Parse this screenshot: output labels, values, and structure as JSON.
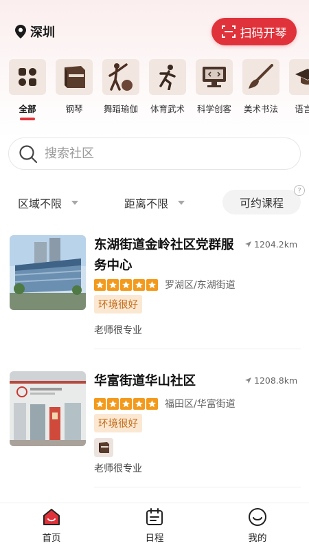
{
  "header": {
    "location": "深圳",
    "scan_button": "扫码开琴"
  },
  "categories": [
    {
      "label": "全部",
      "icon": "grid-icon",
      "active": true
    },
    {
      "label": "钢琴",
      "icon": "piano-icon"
    },
    {
      "label": "舞蹈瑜伽",
      "icon": "dancer-icon"
    },
    {
      "label": "体育武术",
      "icon": "runner-icon"
    },
    {
      "label": "科学创客",
      "icon": "monitor-icon"
    },
    {
      "label": "美术书法",
      "icon": "brush-icon"
    },
    {
      "label": "语言口",
      "icon": "graduation-cap-icon"
    }
  ],
  "search": {
    "placeholder": "搜索社区"
  },
  "filters": {
    "area": "区域不限",
    "distance": "距离不限",
    "bookable": "可约课程",
    "help": "?"
  },
  "communities": [
    {
      "title": "东湖街道金岭社区党群服务中心",
      "distance": "1204.2km",
      "rating": 5,
      "district": "罗湖区/东湖街道",
      "tag": "环境很好",
      "comment": "老师很专业"
    },
    {
      "title": "华富街道华山社区",
      "distance": "1208.8km",
      "rating": 5,
      "district": "福田区/华富街道",
      "tag": "环境很好",
      "course_icon": "piano-icon",
      "comment": "老师很专业"
    }
  ],
  "tabbar": [
    {
      "label": "首页",
      "icon": "home-icon",
      "active": true
    },
    {
      "label": "日程",
      "icon": "calendar-icon"
    },
    {
      "label": "我的",
      "icon": "smile-icon"
    }
  ],
  "colors": {
    "accent": "#e0323a",
    "star": "#f39a1c",
    "tag_bg": "#fbe8d3",
    "tag_text": "#c26a16"
  }
}
